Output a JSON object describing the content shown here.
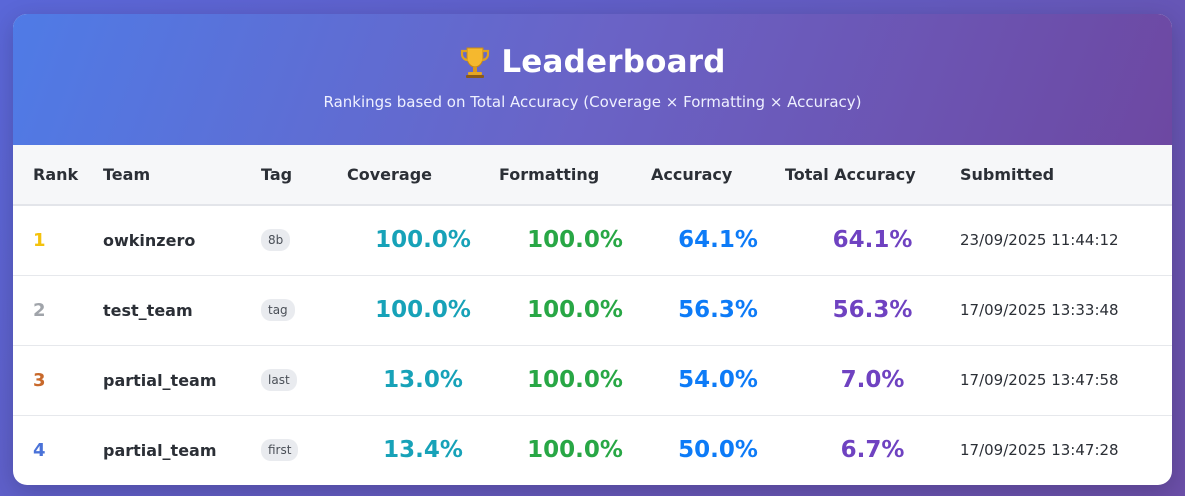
{
  "header": {
    "title": "Leaderboard",
    "subtitle": "Rankings based on Total Accuracy (Coverage × Formatting × Accuracy)",
    "icon": "trophy-icon"
  },
  "columns": {
    "rank": "Rank",
    "team": "Team",
    "tag": "Tag",
    "coverage": "Coverage",
    "formatting": "Formatting",
    "accuracy": "Accuracy",
    "total": "Total Accuracy",
    "submitted": "Submitted"
  },
  "rows": [
    {
      "rank": "1",
      "rank_color": "#f4c20d",
      "team": "owkinzero",
      "tag": "8b",
      "coverage": "100.0%",
      "formatting": "100.0%",
      "accuracy": "64.1%",
      "total": "64.1%",
      "submitted": "23/09/2025 11:44:12"
    },
    {
      "rank": "2",
      "rank_color": "#a0a4aa",
      "team": "test_team",
      "tag": "tag",
      "coverage": "100.0%",
      "formatting": "100.0%",
      "accuracy": "56.3%",
      "total": "56.3%",
      "submitted": "17/09/2025 13:33:48"
    },
    {
      "rank": "3",
      "rank_color": "#c8692b",
      "team": "partial_team",
      "tag": "last",
      "coverage": "13.0%",
      "formatting": "100.0%",
      "accuracy": "54.0%",
      "total": "7.0%",
      "submitted": "17/09/2025 13:47:58"
    },
    {
      "rank": "4",
      "rank_color": "#4a72d8",
      "team": "partial_team",
      "tag": "first",
      "coverage": "13.4%",
      "formatting": "100.0%",
      "accuracy": "50.0%",
      "total": "6.7%",
      "submitted": "17/09/2025 13:47:28"
    }
  ]
}
